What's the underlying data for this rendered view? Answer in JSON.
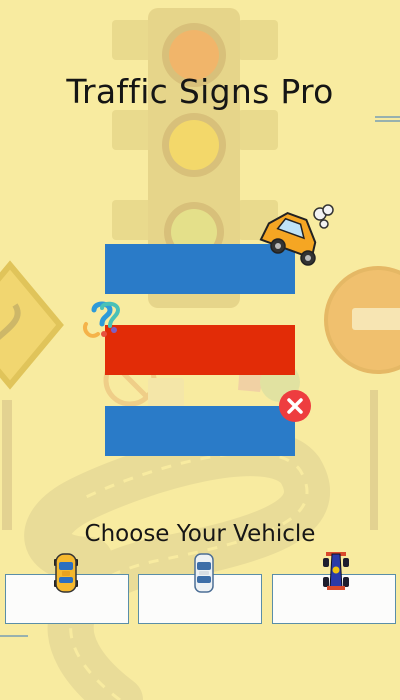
{
  "title": "Traffic Signs Pro",
  "menu": {
    "buttons": [
      {
        "name": "menu-button-1",
        "color": "#2a7bc8"
      },
      {
        "name": "menu-button-2",
        "color": "#e22c07"
      },
      {
        "name": "menu-button-3",
        "color": "#2a7bc8"
      }
    ]
  },
  "vehicle_section": {
    "label": "Choose Your Vehicle",
    "options": [
      {
        "icon": "yellow-taxi-car-icon"
      },
      {
        "icon": "white-sedan-car-icon"
      },
      {
        "icon": "blue-race-car-icon"
      }
    ]
  },
  "icons": {
    "traffic_light": "traffic-light-icon",
    "taxi": "cartoon-taxi-icon",
    "question_mark": "question-mark-icon",
    "close": "close-icon"
  },
  "colors": {
    "background": "#f8eba0",
    "primary_button": "#2a7bc8",
    "accent_button": "#e22c07",
    "close_button": "#ee3d3f"
  }
}
